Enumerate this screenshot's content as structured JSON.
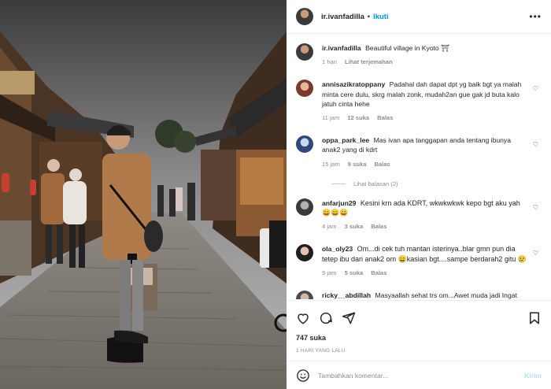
{
  "post": {
    "username": "ir.ivanfadilla",
    "follow_label": "Ikuti",
    "more_icon": "more-options-icon"
  },
  "caption": {
    "username": "ir.ivanfadilla",
    "text": "Beautiful village in Kyoto ⛩",
    "time": "1 hari",
    "translate": "Lihat terjemahan"
  },
  "comments": [
    {
      "username": "annisazikratoppany",
      "text": "Padahal dah dapat dpt yg baik bgt ya malah minta cere dulu, skrg malah zonk, mudah2an gue gak jd buta kalo jatuh cinta hehe",
      "time": "11 jam",
      "likes": "12 suka",
      "reply": "Balas"
    },
    {
      "username": "oppa_park_lee",
      "text": "Mas ivan apa tanggapan anda tentang ibunya anak2 yang di kdrt",
      "time": "15 jam",
      "likes": "9 suka",
      "reply": "Balas",
      "view_replies": "Lihat balasan (2)"
    },
    {
      "username": "anfarjun29",
      "text": "Kesini krn ada KDRT, wkwkwkwk kepo bgt aku yah 😄😄😄",
      "time": "4 jam",
      "likes": "3 suka",
      "reply": "Balas"
    },
    {
      "username": "ola_oly23",
      "text": "Om...di cek tuh mantan isterinya..blar gmn pun dia tetep ibu dari anak2 om 😄kasian bgt....sampe berdarah2 gitu 😢",
      "time": "9 jam",
      "likes": "5 suka",
      "reply": "Balas"
    },
    {
      "username": "ricky__abdillah",
      "text": "Masyaallah sehat trs om...Awet muda jadi Ingat",
      "time": "",
      "likes": "",
      "reply": ""
    }
  ],
  "actions": {
    "likes": "747 suka",
    "date": "1 HARI YANG LALU"
  },
  "add_comment": {
    "placeholder": "Tambahkan komentar...",
    "post_label": "Kirim"
  },
  "colors": {
    "accent": "#0095f6",
    "muted": "#8e8e8e",
    "post_disabled": "#b2dffc"
  }
}
